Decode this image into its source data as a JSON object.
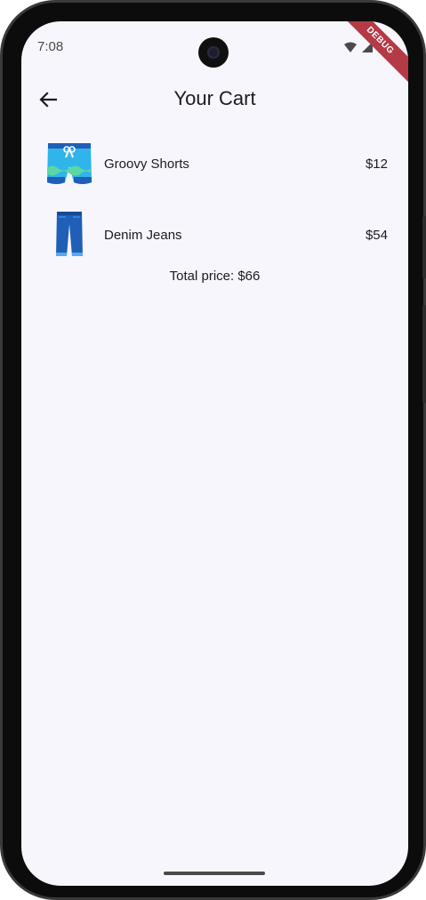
{
  "status_bar": {
    "time": "7:08",
    "debug_label": "DEBUG"
  },
  "appbar": {
    "title": "Your Cart"
  },
  "cart": {
    "items": [
      {
        "name": "Groovy Shorts",
        "price": "$12",
        "icon": "shorts-icon"
      },
      {
        "name": "Denim Jeans",
        "price": "$54",
        "icon": "jeans-icon"
      }
    ],
    "total": "Total price: $66"
  },
  "colors": {
    "background": "#f7f6fc",
    "debug_banner": "#b43a45"
  }
}
